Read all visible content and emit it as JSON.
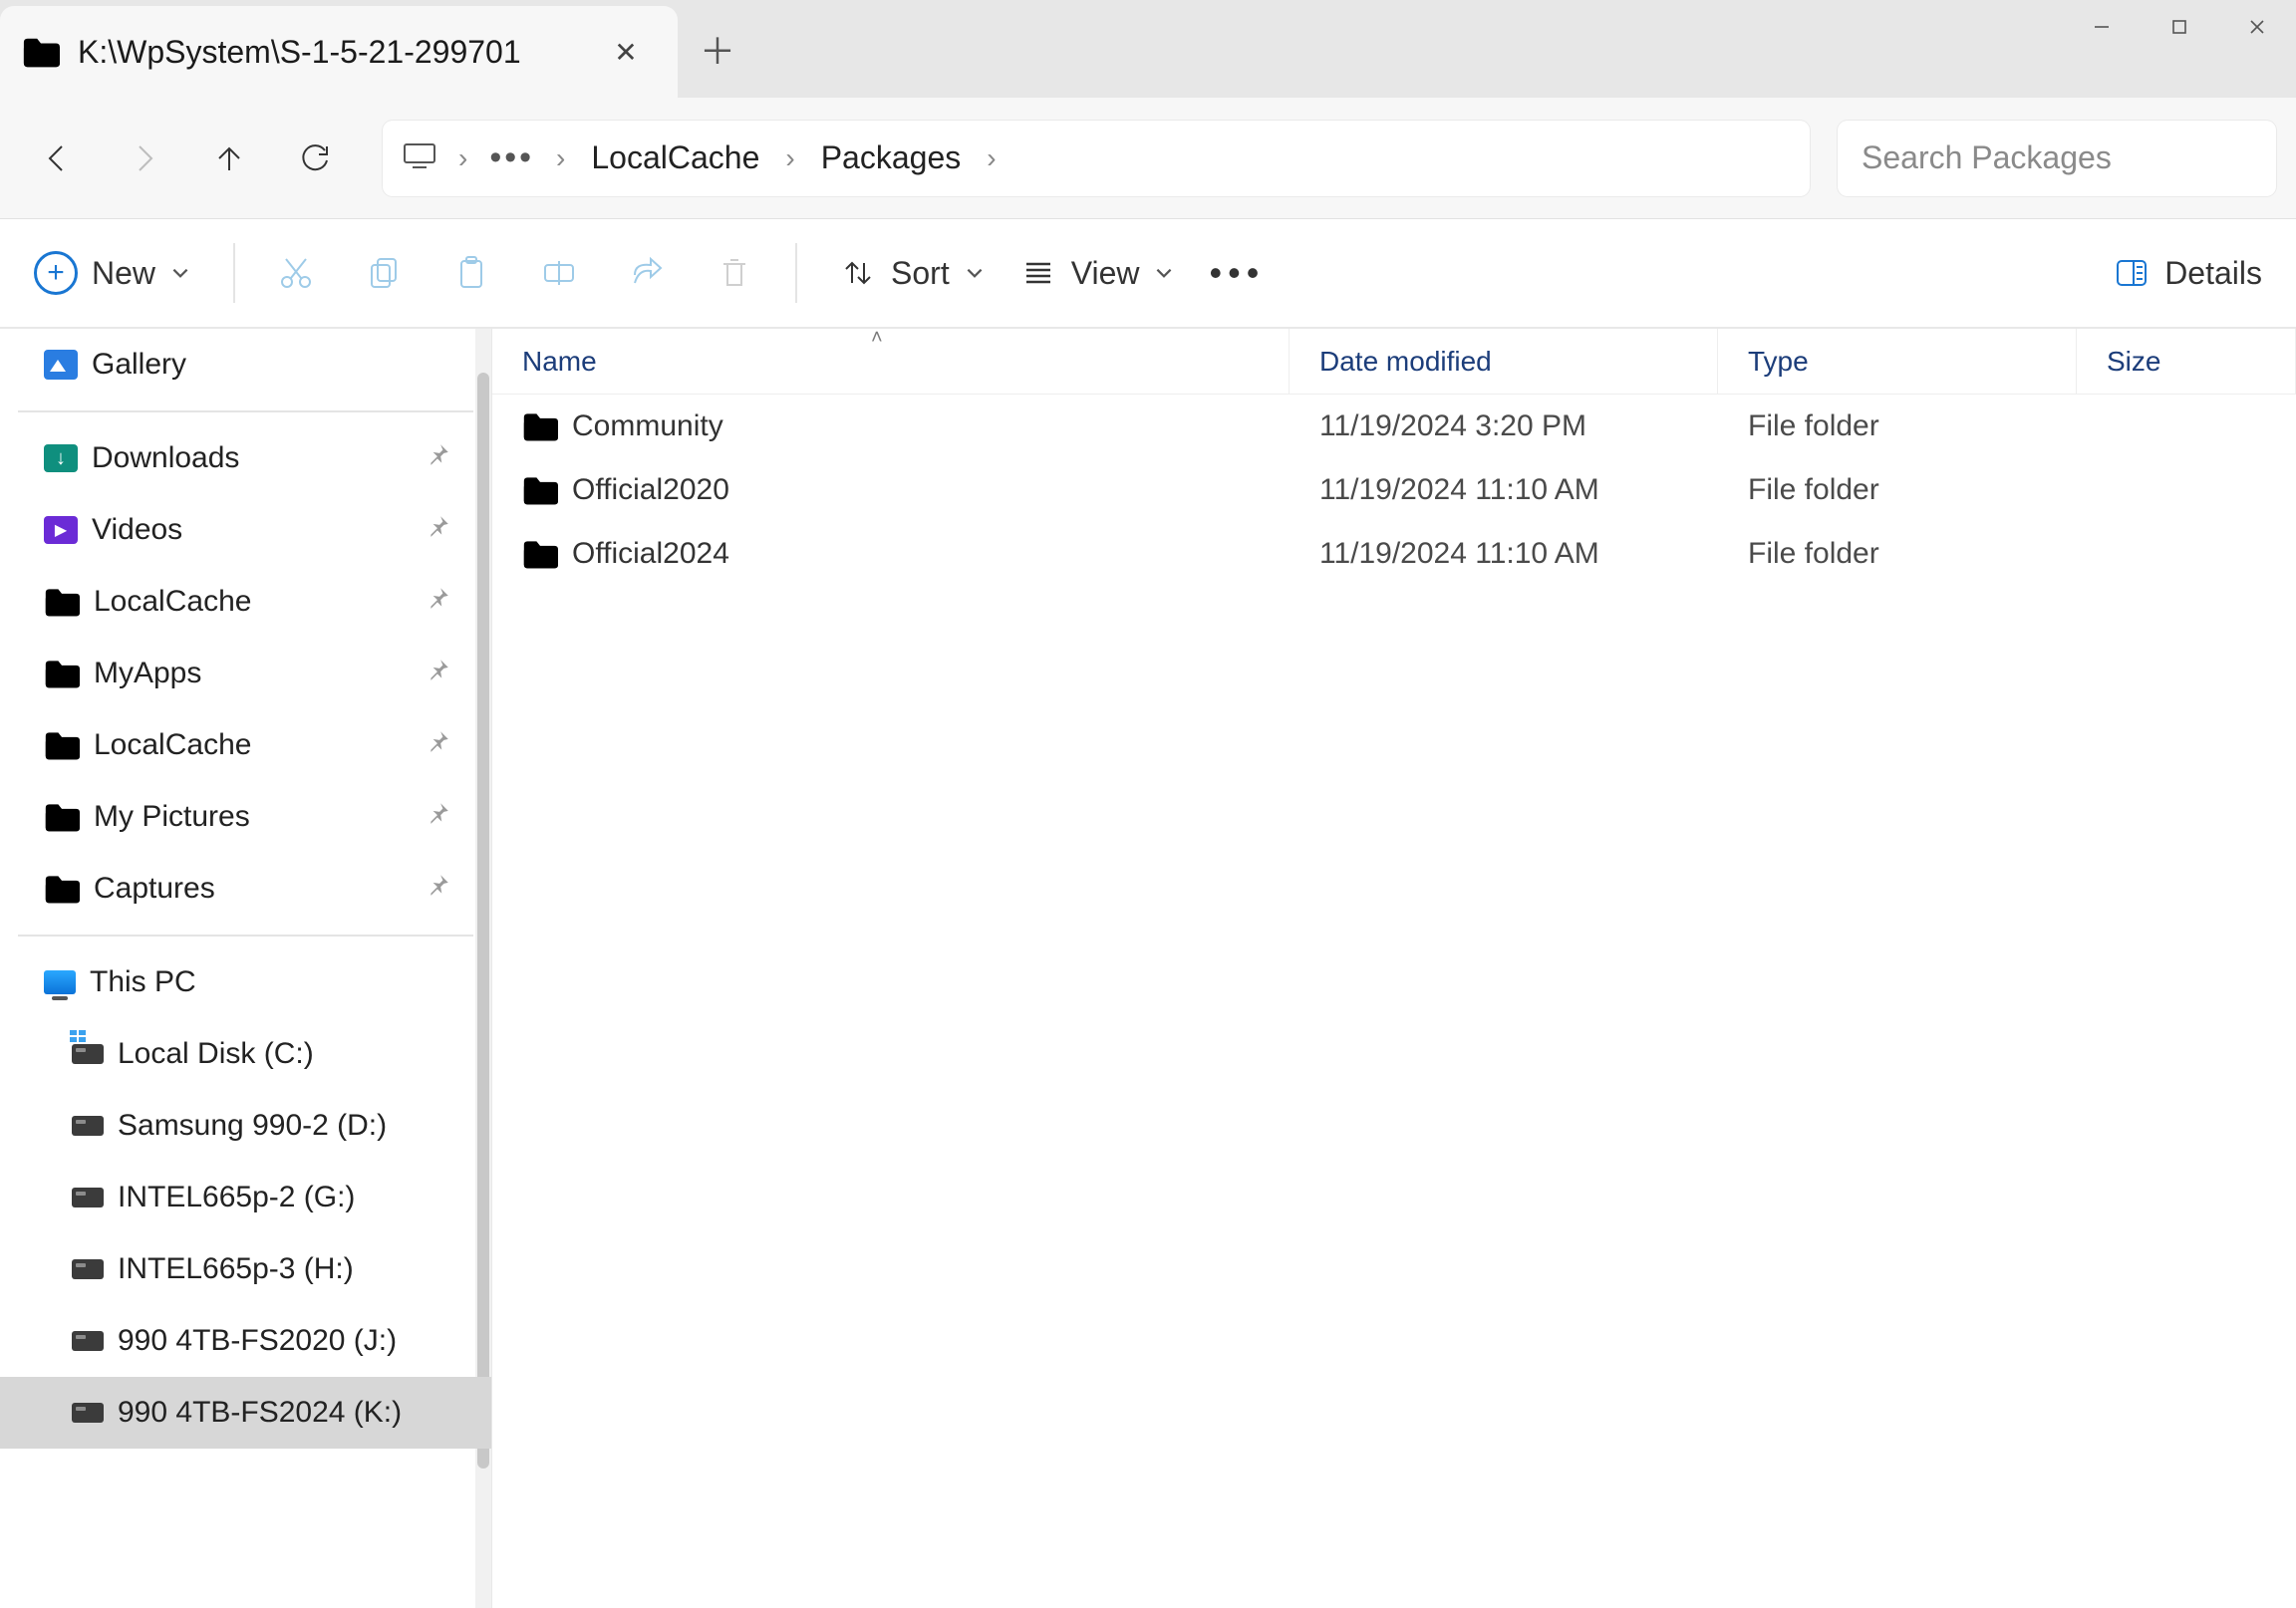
{
  "window": {
    "tab_title": "K:\\WpSystem\\S-1-5-21-299701"
  },
  "nav": {
    "breadcrumbs": [
      "LocalCache",
      "Packages"
    ],
    "search_placeholder": "Search Packages"
  },
  "toolbar": {
    "new_label": "New",
    "sort_label": "Sort",
    "view_label": "View",
    "details_label": "Details"
  },
  "columns": {
    "name": "Name",
    "date": "Date modified",
    "type": "Type",
    "size": "Size"
  },
  "rows": [
    {
      "name": "Community",
      "date": "11/19/2024 3:20 PM",
      "type": "File folder",
      "size": ""
    },
    {
      "name": "Official2020",
      "date": "11/19/2024 11:10 AM",
      "type": "File folder",
      "size": ""
    },
    {
      "name": "Official2024",
      "date": "11/19/2024 11:10 AM",
      "type": "File folder",
      "size": ""
    }
  ],
  "sidebar": {
    "gallery": "Gallery",
    "quick": [
      {
        "label": "Downloads",
        "icon": "downloads"
      },
      {
        "label": "Videos",
        "icon": "videos"
      },
      {
        "label": "LocalCache",
        "icon": "folder"
      },
      {
        "label": "MyApps",
        "icon": "folder"
      },
      {
        "label": "LocalCache",
        "icon": "folder-shortcut"
      },
      {
        "label": "My Pictures",
        "icon": "folder"
      },
      {
        "label": "Captures",
        "icon": "folder"
      }
    ],
    "this_pc": "This PC",
    "drives": [
      {
        "label": "Local Disk (C:)",
        "win": true
      },
      {
        "label": "Samsung 990-2 (D:)",
        "win": false
      },
      {
        "label": "INTEL665p-2 (G:)",
        "win": false
      },
      {
        "label": "INTEL665p-3 (H:)",
        "win": false
      },
      {
        "label": "990 4TB-FS2020 (J:)",
        "win": false
      },
      {
        "label": "990 4TB-FS2024 (K:)",
        "win": false,
        "selected": true
      }
    ]
  }
}
